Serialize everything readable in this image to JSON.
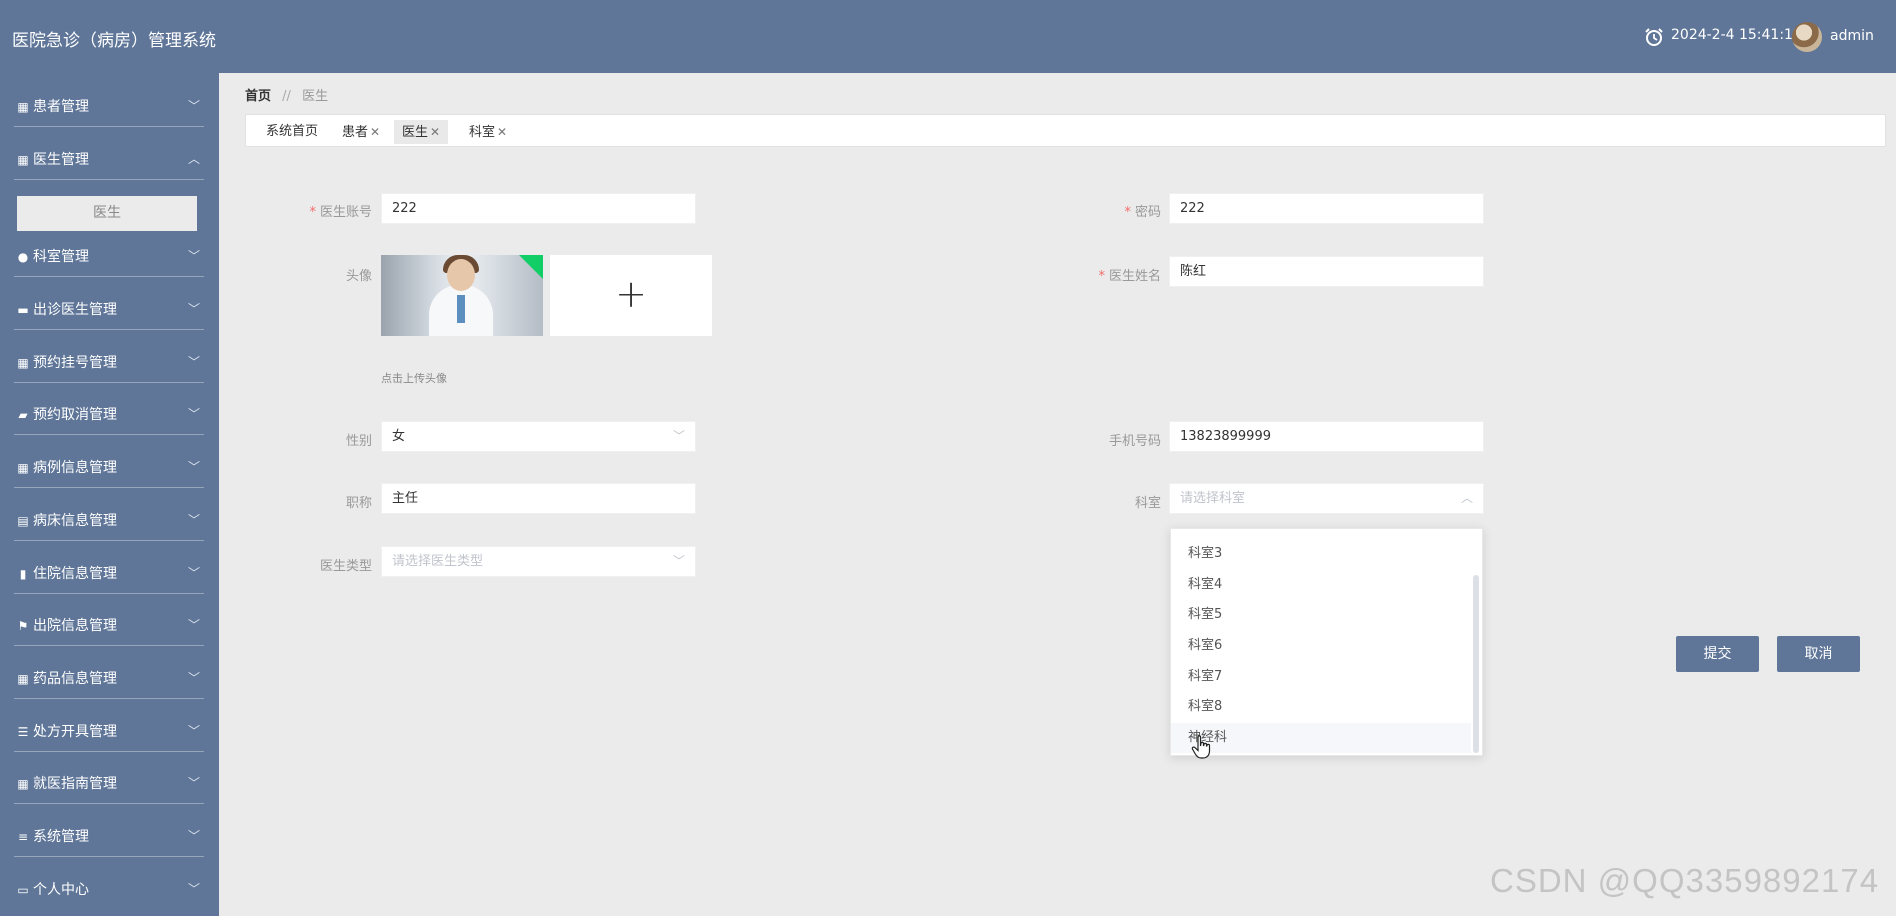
{
  "header": {
    "app_title": "医院急诊（病房）管理系统",
    "datetime": "2024-2-4 15:41:12",
    "username": "admin"
  },
  "sidebar": {
    "items": [
      {
        "label": "患者管理",
        "icon": "grid-icon",
        "expanded": false
      },
      {
        "label": "医生管理",
        "icon": "grid-icon",
        "expanded": true
      },
      {
        "label": "科室管理",
        "icon": "pin-icon",
        "expanded": false
      },
      {
        "label": "出诊医生管理",
        "icon": "briefcase-icon",
        "expanded": false
      },
      {
        "label": "预约挂号管理",
        "icon": "grid-icon",
        "expanded": false
      },
      {
        "label": "预约取消管理",
        "icon": "chat-icon",
        "expanded": false
      },
      {
        "label": "病例信息管理",
        "icon": "grid-icon",
        "expanded": false
      },
      {
        "label": "病床信息管理",
        "icon": "clipboard-icon",
        "expanded": false
      },
      {
        "label": "住院信息管理",
        "icon": "bar-chart-icon",
        "expanded": false
      },
      {
        "label": "出院信息管理",
        "icon": "flag-icon",
        "expanded": false
      },
      {
        "label": "药品信息管理",
        "icon": "grid-icon",
        "expanded": false
      },
      {
        "label": "处方开具管理",
        "icon": "sliders-icon",
        "expanded": false
      },
      {
        "label": "就医指南管理",
        "icon": "grid-icon",
        "expanded": false
      },
      {
        "label": "系统管理",
        "icon": "list-icon",
        "expanded": false
      },
      {
        "label": "个人中心",
        "icon": "card-icon",
        "expanded": false
      }
    ],
    "submenu_doctor": "医生"
  },
  "breadcrumb": {
    "home": "首页",
    "separator": "//",
    "current": "医生"
  },
  "tabs": [
    {
      "label": "系统首页",
      "closable": false,
      "active": false
    },
    {
      "label": "患者",
      "closable": true,
      "active": false
    },
    {
      "label": "医生",
      "closable": true,
      "active": true
    },
    {
      "label": "科室",
      "closable": true,
      "active": false
    }
  ],
  "form": {
    "account_label": "医生账号",
    "account_value": "222",
    "password_label": "密码",
    "password_value": "222",
    "avatar_label": "头像",
    "avatar_hint": "点击上传头像",
    "upload_plus": "+",
    "name_label": "医生姓名",
    "name_value": "陈红",
    "gender_label": "性别",
    "gender_value": "女",
    "phone_label": "手机号码",
    "phone_value": "13823899999",
    "title_label": "职称",
    "title_value": "主任",
    "dept_label": "科室",
    "dept_placeholder": "请选择科室",
    "type_label": "医生类型",
    "type_placeholder": "请选择医生类型"
  },
  "dept_options": [
    "科室3",
    "科室4",
    "科室5",
    "科室6",
    "科室7",
    "科室8",
    "神经科"
  ],
  "buttons": {
    "submit": "提交",
    "cancel": "取消"
  },
  "watermark": "CSDN @QQ3359892174",
  "colors": {
    "primary": "#5f7698",
    "background": "#ebebeb",
    "required": "#f56c6c",
    "photo_badge": "#13ce66"
  }
}
